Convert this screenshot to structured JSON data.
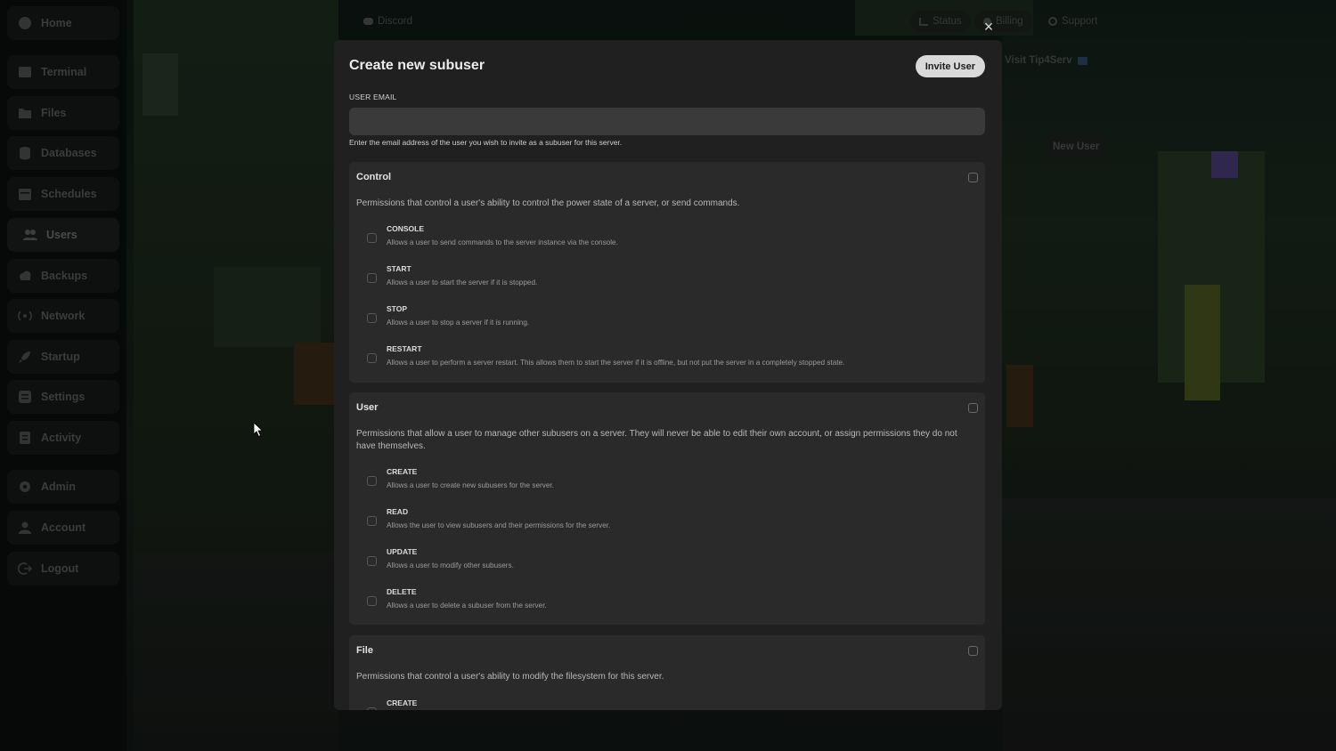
{
  "sidebar": {
    "items": [
      {
        "label": "Home",
        "icon": "home-icon"
      },
      {
        "label": "Terminal",
        "icon": "terminal-icon"
      },
      {
        "label": "Files",
        "icon": "folder-icon"
      },
      {
        "label": "Databases",
        "icon": "database-icon"
      },
      {
        "label": "Schedules",
        "icon": "calendar-icon"
      },
      {
        "label": "Users",
        "icon": "users-icon"
      },
      {
        "label": "Backups",
        "icon": "cloud-icon"
      },
      {
        "label": "Network",
        "icon": "network-icon"
      },
      {
        "label": "Startup",
        "icon": "rocket-icon"
      },
      {
        "label": "Settings",
        "icon": "settings-icon"
      },
      {
        "label": "Activity",
        "icon": "activity-icon"
      },
      {
        "label": "Admin",
        "icon": "gear-icon"
      },
      {
        "label": "Account",
        "icon": "user-icon"
      },
      {
        "label": "Logout",
        "icon": "logout-icon"
      }
    ]
  },
  "topbar": {
    "discord": "Discord",
    "status": "Status",
    "billing": "Billing",
    "support": "Support"
  },
  "background": {
    "visit": "Visit Tip4Serv",
    "new_user": "New User"
  },
  "modal": {
    "title": "Create new subuser",
    "invite_button": "Invite User",
    "email_label": "USER EMAIL",
    "email_value": "",
    "email_help": "Enter the email address of the user you wish to invite as a subuser for this server.",
    "close": "×",
    "groups": [
      {
        "title": "Control",
        "description": "Permissions that control a user's ability to control the power state of a server, or send commands.",
        "permissions": [
          {
            "name": "CONSOLE",
            "description": "Allows a user to send commands to the server instance via the console."
          },
          {
            "name": "START",
            "description": "Allows a user to start the server if it is stopped."
          },
          {
            "name": "STOP",
            "description": "Allows a user to stop a server if it is running."
          },
          {
            "name": "RESTART",
            "description": "Allows a user to perform a server restart. This allows them to start the server if it is offline, but not put the server in a completely stopped state."
          }
        ]
      },
      {
        "title": "User",
        "description": "Permissions that allow a user to manage other subusers on a server. They will never be able to edit their own account, or assign permissions they do not have themselves.",
        "permissions": [
          {
            "name": "CREATE",
            "description": "Allows a user to create new subusers for the server."
          },
          {
            "name": "READ",
            "description": "Allows the user to view subusers and their permissions for the server."
          },
          {
            "name": "UPDATE",
            "description": "Allows a user to modify other subusers."
          },
          {
            "name": "DELETE",
            "description": "Allows a user to delete a subuser from the server."
          }
        ]
      },
      {
        "title": "File",
        "description": "Permissions that control a user's ability to modify the filesystem for this server.",
        "permissions": [
          {
            "name": "CREATE",
            "description": ""
          }
        ]
      }
    ]
  }
}
